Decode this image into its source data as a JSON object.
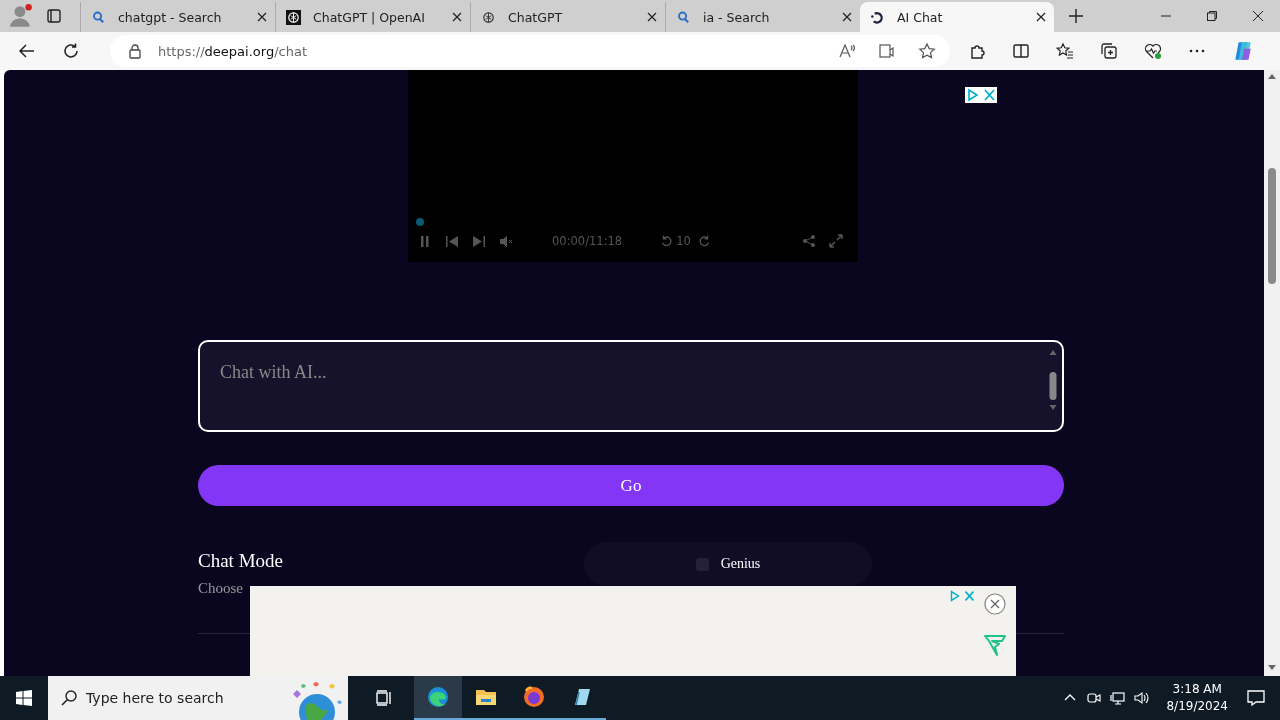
{
  "tabs": [
    {
      "title": "chatgpt - Search",
      "kind": "search",
      "selected": false
    },
    {
      "title": "ChatGPT | OpenAI",
      "kind": "dark",
      "selected": false
    },
    {
      "title": "ChatGPT",
      "kind": "light",
      "selected": false
    },
    {
      "title": "ia - Search",
      "kind": "search",
      "selected": false
    },
    {
      "title": "AI Chat",
      "kind": "site",
      "selected": true
    }
  ],
  "address": {
    "prefix": "https://",
    "domain": "deepai.org",
    "path": "/chat"
  },
  "video": {
    "time": "00:00/11:18",
    "skip": "10",
    "playing": true,
    "muted": true
  },
  "chat": {
    "placeholder": "Chat with AI...",
    "button": "Go"
  },
  "chat_mode": {
    "title": "Chat Mode",
    "description": "Choose",
    "options": [
      {
        "label": "Genius",
        "selected": false
      }
    ]
  },
  "taskbar": {
    "search_placeholder": "Type here to search",
    "time": "3:18 AM",
    "date": "8/19/2024"
  }
}
